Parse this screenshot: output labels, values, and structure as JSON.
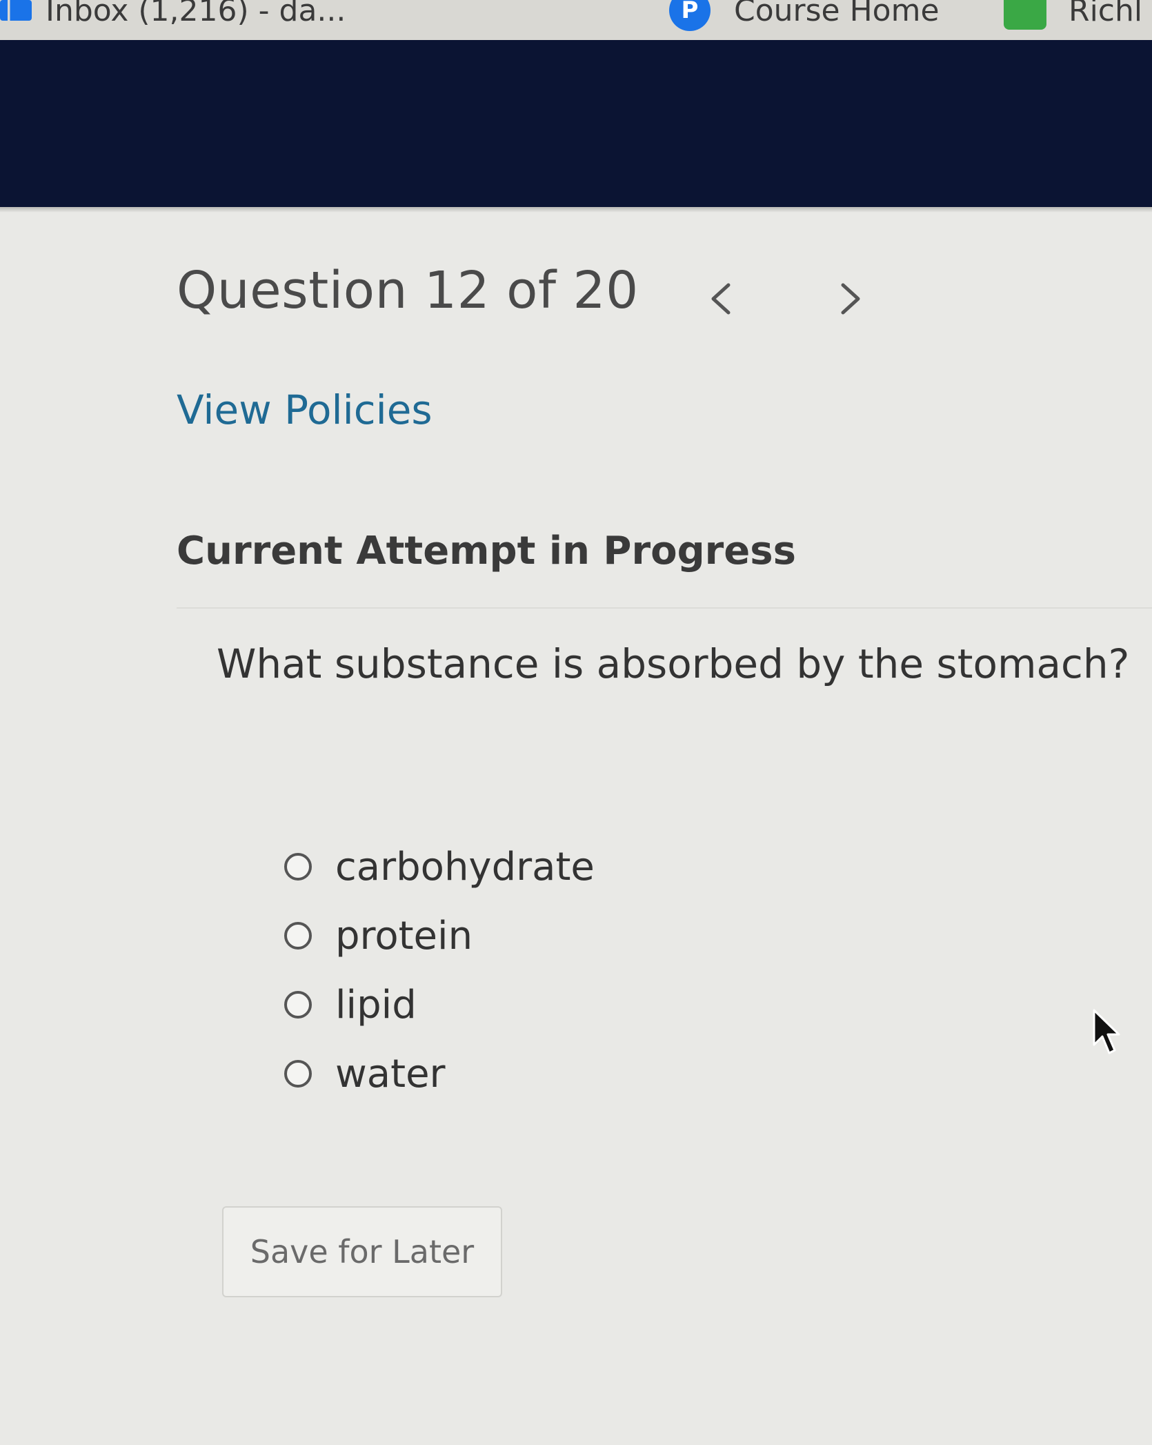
{
  "browser": {
    "bookmarks": [
      {
        "label": "Inbox (1,216) - da...",
        "icon": "gmail-icon"
      },
      {
        "label": "Course Home",
        "icon": "pearson-icon",
        "icon_glyph": "P"
      },
      {
        "label": "Richl",
        "icon": "bookmark-green-icon"
      }
    ]
  },
  "question": {
    "title": "Question 12 of 20",
    "prev_icon": "chevron-left-icon",
    "next_icon": "chevron-right-icon",
    "view_policies": "View Policies",
    "attempt_heading": "Current Attempt in Progress",
    "prompt": "What substance is absorbed by the stomach?",
    "options": [
      {
        "label": "carbohydrate",
        "selected": false
      },
      {
        "label": "protein",
        "selected": false
      },
      {
        "label": "lipid",
        "selected": false
      },
      {
        "label": "water",
        "selected": false
      }
    ],
    "save_label": "Save for Later"
  },
  "colors": {
    "header_bg": "#0b1433",
    "link": "#1f6a94",
    "page_bg": "#e9e9e6"
  }
}
